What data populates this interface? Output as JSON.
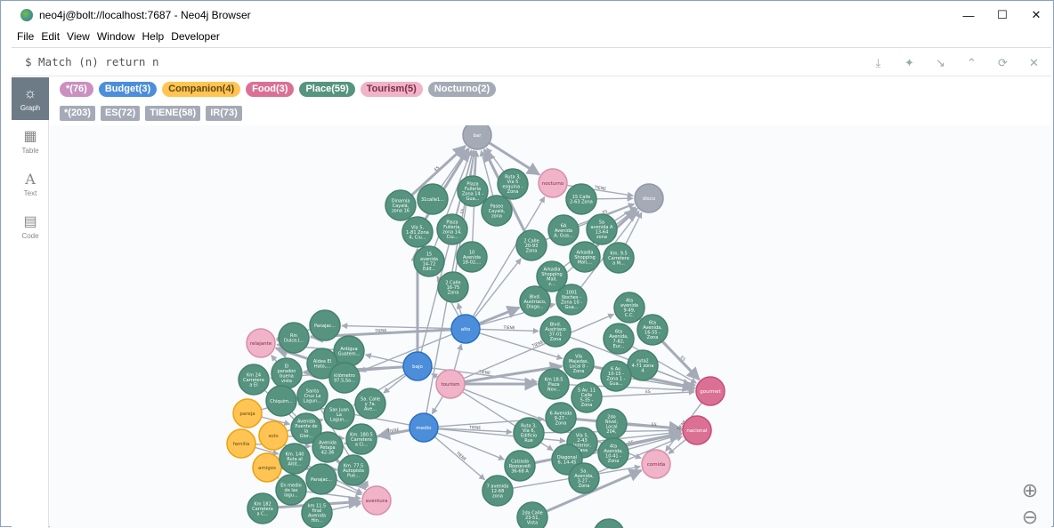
{
  "window": {
    "title": "neo4j@bolt://localhost:7687 - Neo4j Browser"
  },
  "menu": [
    "File",
    "Edit",
    "View",
    "Window",
    "Help",
    "Developer"
  ],
  "editor": {
    "query": "$ Match (n) return n"
  },
  "sidebar": [
    {
      "label": "Graph",
      "icon": "graph-icon"
    },
    {
      "label": "Table",
      "icon": "table-icon"
    },
    {
      "label": "Text",
      "icon": "text-icon"
    },
    {
      "label": "Code",
      "icon": "code-icon"
    }
  ],
  "labels": [
    {
      "text": "*(76)",
      "color": "#c990c0"
    },
    {
      "text": "Budget(3)",
      "color": "#4c8eda"
    },
    {
      "text": "Companion(4)",
      "color": "#ffc454",
      "dark": true
    },
    {
      "text": "Food(3)",
      "color": "#da7194"
    },
    {
      "text": "Place(59)",
      "color": "#569480"
    },
    {
      "text": "Tourism(5)",
      "color": "#f16667",
      "pink": "#f0b3c8",
      "dark": true
    },
    {
      "text": "Nocturno(2)",
      "color": "#a5abb6"
    }
  ],
  "relationships": [
    "*(203)",
    "ES(72)",
    "TIENE(58)",
    "IR(73)"
  ],
  "colors": {
    "place": "#569480",
    "budget": "#4c8eda",
    "companion": "#ffc454",
    "food": "#da7194",
    "tourism": "#f0b3c8",
    "nocturno": "#a5abb6"
  },
  "nodes": [
    {
      "id": "bar",
      "type": "nocturno",
      "label": "bar"
    },
    {
      "id": "disco",
      "type": "nocturno",
      "label": "disco"
    },
    {
      "id": "nocturno",
      "type": "tourism",
      "label": "nocturno"
    },
    {
      "id": "relajante",
      "type": "tourism",
      "label": "relajante"
    },
    {
      "id": "tourism",
      "type": "tourism",
      "label": "tourism"
    },
    {
      "id": "aventura",
      "type": "tourism",
      "label": "aventura"
    },
    {
      "id": "comida",
      "type": "tourism",
      "label": "comida"
    },
    {
      "id": "alto",
      "type": "budget",
      "label": "alto"
    },
    {
      "id": "bajo",
      "type": "budget",
      "label": "bajo"
    },
    {
      "id": "medio",
      "type": "budget",
      "label": "medio"
    },
    {
      "id": "pareja",
      "type": "companion",
      "label": "pareja"
    },
    {
      "id": "solo",
      "type": "companion",
      "label": "solo"
    },
    {
      "id": "familia",
      "type": "companion",
      "label": "familia"
    },
    {
      "id": "amigos",
      "type": "companion",
      "label": "amigos"
    },
    {
      "id": "gourmet",
      "type": "food",
      "label": "gourmet"
    },
    {
      "id": "nacional",
      "type": "food",
      "label": "nacional"
    },
    {
      "id": "p1",
      "type": "place",
      "label": "Dinamia Cayalá, zona 16"
    },
    {
      "id": "p2",
      "type": "place",
      "label": "31calle1..."
    },
    {
      "id": "p3",
      "type": "place",
      "label": "Plaza Fullería Zona 14 - Gua..."
    },
    {
      "id": "p4",
      "type": "place",
      "label": "Ruta 3, Vía 5 esquina - Zona"
    },
    {
      "id": "p5",
      "type": "place",
      "label": "Paseo Cayalá, zona"
    },
    {
      "id": "p6",
      "type": "place",
      "label": "Vía 5, 1-81 Zona 4, Ciu..."
    },
    {
      "id": "p7",
      "type": "place",
      "label": "Plaza Fullería, zona 14, Ciu..."
    },
    {
      "id": "p8",
      "type": "place",
      "label": "15 Calle 2-63 Zona"
    },
    {
      "id": "p9",
      "type": "place",
      "label": "15 avenida 14-72 Edif..."
    },
    {
      "id": "p10",
      "type": "place",
      "label": "10 Avenida 18-02,..."
    },
    {
      "id": "p11",
      "type": "place",
      "label": "2 Calle 16-75 Zona"
    },
    {
      "id": "p12",
      "type": "place",
      "label": "6A Avenida A, Gua..."
    },
    {
      "id": "p13",
      "type": "place",
      "label": "5a avenida A 13-64 zona"
    },
    {
      "id": "p14",
      "type": "place",
      "label": "2 Calle 20-93 Zona"
    },
    {
      "id": "p15",
      "type": "place",
      "label": "Arkadia Shopping Mall,..."
    },
    {
      "id": "p16",
      "type": "place",
      "label": "Km. 9.5 Carretera a M..."
    },
    {
      "id": "p17",
      "type": "place",
      "label": "Arkadia Shopping Mall, z..."
    },
    {
      "id": "p18",
      "type": "place",
      "label": "Blvd. Austriaco, Diago..."
    },
    {
      "id": "p19",
      "type": "place",
      "label": "1001 Noches - Zona 10 - Gua..."
    },
    {
      "id": "p20",
      "type": "place",
      "label": "4ta avenida 9-49, C.C."
    },
    {
      "id": "p21",
      "type": "place",
      "label": "Blvd. Austriaco 37-01 Zona"
    },
    {
      "id": "p22",
      "type": "place",
      "label": "6ta Avenida, 16-55 - Zona"
    },
    {
      "id": "p23",
      "type": "place",
      "label": "6ta Avenida, 7-82, Eur..."
    },
    {
      "id": "p24",
      "type": "place",
      "label": "ruta2 4-71 zona 4"
    },
    {
      "id": "p25",
      "type": "place",
      "label": "Vía Majadas, Local 8 - Zona"
    },
    {
      "id": "p26",
      "type": "place",
      "label": "6 Av. 10-15 - Zona 1 - Gua..."
    },
    {
      "id": "p27",
      "type": "place",
      "label": "Km 18.5 Plaza Nov..."
    },
    {
      "id": "p28",
      "type": "place",
      "label": "5 Av. 11 Calle 5-35 - Zona"
    },
    {
      "id": "p29",
      "type": "place",
      "label": "Panajac..."
    },
    {
      "id": "p30",
      "type": "place",
      "label": "Rin Dulce,l..."
    },
    {
      "id": "p31",
      "type": "place",
      "label": "Antigua Guatem..."
    },
    {
      "id": "p32",
      "type": "place",
      "label": "Aldea El Hato,..."
    },
    {
      "id": "p33",
      "type": "place",
      "label": "El paradon buena vista"
    },
    {
      "id": "p34",
      "type": "place",
      "label": "Km 24 Carretera a El"
    },
    {
      "id": "p35",
      "type": "place",
      "label": "kilómetro 97.5,Sa..."
    },
    {
      "id": "p36",
      "type": "place",
      "label": "Santa Cruz La Lagun..."
    },
    {
      "id": "p37",
      "type": "place",
      "label": "5a. Calle y 7a. Ave..."
    },
    {
      "id": "p38",
      "type": "place",
      "label": "Chiquim..."
    },
    {
      "id": "p39",
      "type": "place",
      "label": "San Juan La Lagun..."
    },
    {
      "id": "p40",
      "type": "place",
      "label": "Avenida Puente de la Glor..."
    },
    {
      "id": "p41",
      "type": "place",
      "label": "Km. 180.5 Carretera a Ci..."
    },
    {
      "id": "p42",
      "type": "place",
      "label": "Avenida Petapa 42-36"
    },
    {
      "id": "p43",
      "type": "place",
      "label": "Km. 140 Ruta al Altit..."
    },
    {
      "id": "p44",
      "type": "place",
      "label": "Km. 77.5 Autopista Pue..."
    },
    {
      "id": "p45",
      "type": "place",
      "label": "Panajac..."
    },
    {
      "id": "p46",
      "type": "place",
      "label": "En medio de las lagu..."
    },
    {
      "id": "p47",
      "type": "place",
      "label": "Km 182 Carretera a C..."
    },
    {
      "id": "p48",
      "type": "place",
      "label": "km 11.5 final Avenida Hin..."
    },
    {
      "id": "p49",
      "type": "place",
      "label": "Ruta 3, Vía 6, Edificio Rue"
    },
    {
      "id": "p50",
      "type": "place",
      "label": "6 Avenida 9-27 - Zona"
    },
    {
      "id": "p51",
      "type": "place",
      "label": "2do Nivel, Local 204,"
    },
    {
      "id": "p52",
      "type": "place",
      "label": "Vía 5, 2-43 Interior, Casa"
    },
    {
      "id": "p53",
      "type": "place",
      "label": "4ta Avenida, 10-41 - Zona"
    },
    {
      "id": "p54",
      "type": "place",
      "label": "Diagonal 6, 14-45"
    },
    {
      "id": "p55",
      "type": "place",
      "label": "Calzada Roosevelt 36-68 A"
    },
    {
      "id": "p56",
      "type": "place",
      "label": "5a. Avenida, 3-27 - Zona"
    },
    {
      "id": "p57",
      "type": "place",
      "label": "7 avenida 12-68 zona"
    },
    {
      "id": "p58",
      "type": "place",
      "label": "2da Calle 23-51, Vista"
    },
    {
      "id": "p59",
      "type": "place",
      "label": ""
    }
  ],
  "edge_labels": [
    "TIENE",
    "ES",
    "IR"
  ]
}
